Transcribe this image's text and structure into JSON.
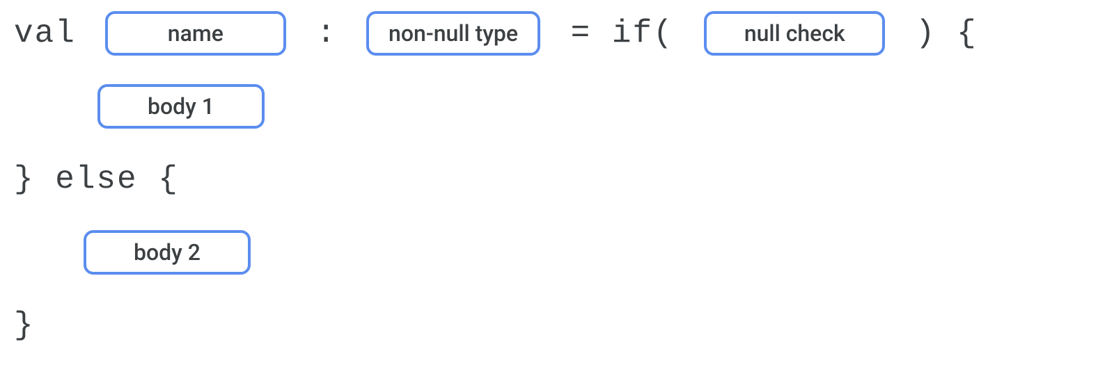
{
  "code": {
    "keyword_val": "val",
    "colon": " :",
    "equals_if_paren": " = if( ",
    "close_paren_brace": " ) {",
    "close_else_open": "} else {",
    "close_brace": "}"
  },
  "placeholders": {
    "name": "name",
    "non_null_type": "non-null type",
    "null_check": "null check",
    "body1": "body 1",
    "body2": "body 2"
  }
}
